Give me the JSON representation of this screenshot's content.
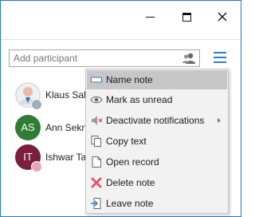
{
  "titlebar": {
    "minimize_icon": "minimize-icon",
    "maximize_icon": "maximize-icon",
    "close_icon": "close-icon"
  },
  "search": {
    "placeholder": "Add participant",
    "value": "",
    "icon": "add-person-icon"
  },
  "menu_button": {
    "icon": "hamburger-icon"
  },
  "participants": [
    {
      "name": "Klaus Sald",
      "initials": "",
      "avatar_color": "#e8d9cf",
      "badge": "status-away-icon"
    },
    {
      "name": "Ann Sekne",
      "initials": "AS",
      "avatar_color": "#2e7d32",
      "badge": ""
    },
    {
      "name": "Ishwar Tag",
      "initials": "IT",
      "avatar_color": "#7a1f3d",
      "badge": "status-blocked-icon"
    }
  ],
  "context_menu": {
    "items": [
      {
        "label": "Name note",
        "icon": "rename-icon",
        "active": true
      },
      {
        "label": "Mark as unread",
        "icon": "eye-icon"
      },
      {
        "label": "Deactivate notifications",
        "icon": "mute-icon",
        "submenu": true
      },
      {
        "label": "Copy text",
        "icon": "copy-icon"
      },
      {
        "label": "Open record",
        "icon": "document-icon"
      },
      {
        "label": "Delete note",
        "icon": "delete-icon"
      },
      {
        "label": "Leave note",
        "icon": "leave-icon"
      }
    ]
  },
  "colors": {
    "accent": "#2b7fd2",
    "window_border": "#1f7ac6",
    "menu_bg": "#f2f2f2",
    "menu_active": "#c7c7c7",
    "delete_red": "#e2596d"
  }
}
